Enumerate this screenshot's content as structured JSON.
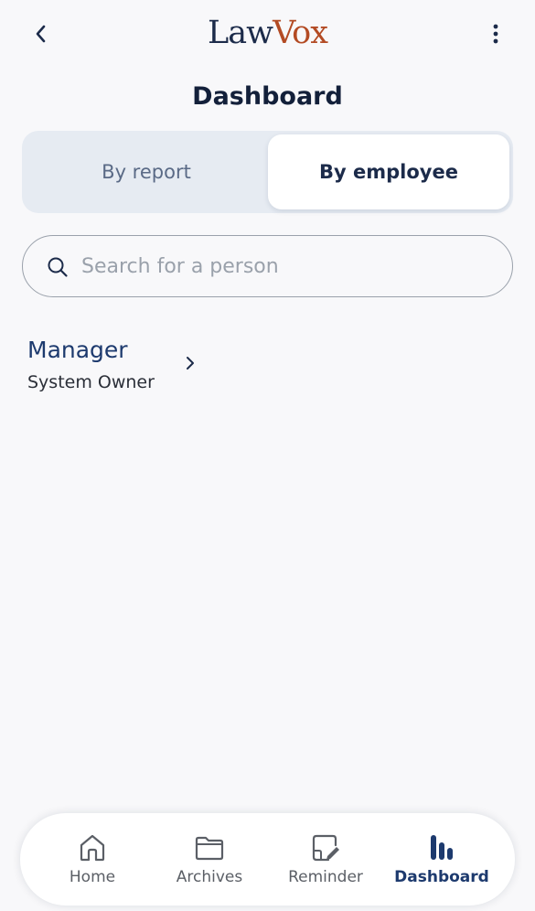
{
  "header": {
    "logo_part1": "Law",
    "logo_part2": "Vox",
    "back_icon": "chevron-left-icon",
    "menu_icon": "more-vertical-icon"
  },
  "page_title": "Dashboard",
  "segmented": {
    "options": [
      {
        "label": "By report",
        "selected": false
      },
      {
        "label": "By employee",
        "selected": true
      }
    ]
  },
  "search": {
    "placeholder": "Search for a person",
    "value": ""
  },
  "people": [
    {
      "name": "Manager",
      "role": "System Owner"
    }
  ],
  "bottom_nav": {
    "items": [
      {
        "label": "Home",
        "icon": "home-icon",
        "active": false
      },
      {
        "label": "Archives",
        "icon": "folder-icon",
        "active": false
      },
      {
        "label": "Reminder",
        "icon": "note-edit-icon",
        "active": false
      },
      {
        "label": "Dashboard",
        "icon": "bar-chart-icon",
        "active": true
      }
    ]
  },
  "colors": {
    "brand_navy": "#1c2b4a",
    "brand_rust": "#b34b24",
    "accent": "#1d3a6e",
    "background": "#f8f8fa"
  }
}
